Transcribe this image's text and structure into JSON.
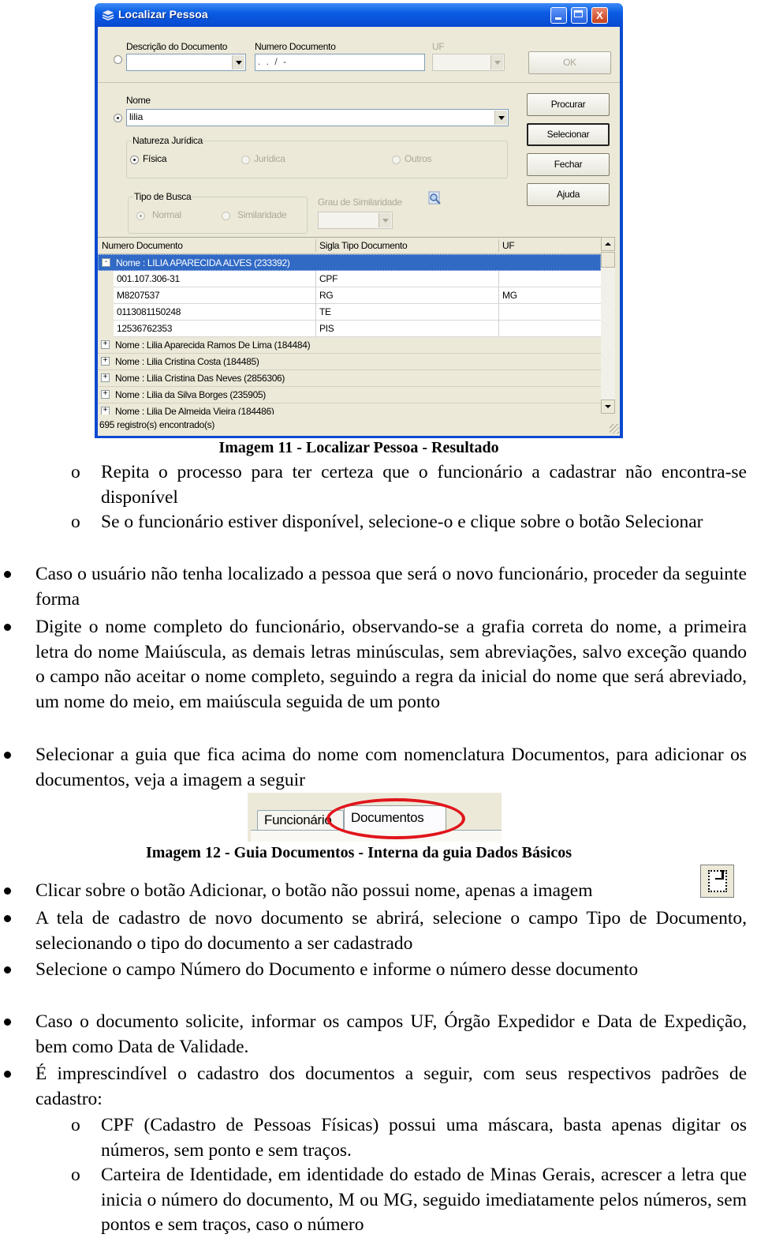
{
  "window": {
    "title": "Localizar Pessoa",
    "title_icon": "stack-icon",
    "controls": [
      "minimize",
      "maximize",
      "close"
    ],
    "close_glyph": "X",
    "document_search": {
      "descricao_label": "Descrição do Documento",
      "descricao_value": "",
      "numero_label": "Numero Documento",
      "numero_value": " .  .  /  -",
      "uf_label": "UF",
      "uf_value": ""
    },
    "name_search": {
      "label": "Nome",
      "value": "lilia"
    },
    "natureza": {
      "title": "Natureza Jurídica",
      "options": [
        "Física",
        "Jurídica",
        "Outros"
      ],
      "selected": "Física"
    },
    "tipo_busca": {
      "title": "Tipo de Busca",
      "options": [
        "Normal",
        "Similaridade"
      ],
      "selected": "Normal"
    },
    "similaridade": {
      "label": "Grau de Similaridade",
      "value": ""
    },
    "buttons": {
      "ok": "OK",
      "procurar": "Procurar",
      "selecionar": "Selecionar",
      "fechar": "Fechar",
      "ajuda": "Ajuda"
    },
    "grid": {
      "columns": [
        "Numero Documento",
        "Sigla Tipo Documento",
        "UF"
      ],
      "expanded_group": {
        "label": "Nome : LILIA APARECIDA ALVES (233392)",
        "toggle": "-",
        "rows": [
          {
            "numero": "001.107.306-31",
            "sigla": "CPF",
            "uf": ""
          },
          {
            "numero": "M8207537",
            "sigla": "RG",
            "uf": "MG"
          },
          {
            "numero": "0113081150248",
            "sigla": "TE",
            "uf": ""
          },
          {
            "numero": "12536762353",
            "sigla": "PIS",
            "uf": ""
          }
        ]
      },
      "collapsed_groups": [
        {
          "label": "Nome : Lilia Aparecida Ramos De Lima (184484)",
          "toggle": "+"
        },
        {
          "label": "Nome : Lilia Cristina Costa (184485)",
          "toggle": "+"
        },
        {
          "label": "Nome : Lilia Cristina Das Neves (2856306)",
          "toggle": "+"
        },
        {
          "label": "Nome : Lilia da Silva Borges (235905)",
          "toggle": "+"
        },
        {
          "label": "Nome : Lilia De Almeida Vieira (184486)",
          "toggle": "+"
        }
      ]
    },
    "status": "695 registro(s) encontrado(s)"
  },
  "doc": {
    "caption1": "Imagem 11 - Localizar Pessoa - Resultado",
    "sub_marker": "o",
    "sub1": "Repita o processo para ter certeza que o funcionário a cadastrar não encontra-se disponível",
    "sub2": "Se o funcionário estiver disponível, selecione-o e clique sobre o botão Selecionar",
    "b1": "Caso o usuário não tenha localizado a pessoa que será o novo funcionário, proceder da seguinte forma",
    "b2": "Digite o nome completo do funcionário, observando-se a grafia correta do nome, a primeira letra do nome Maiúscula, as demais letras minúsculas, sem abreviações, salvo exceção quando o campo não aceitar o nome completo, seguindo a regra da inicial do nome que será abreviado, um nome do meio, em maiúscula seguida de um ponto",
    "b3": "Selecionar a guia que fica acima do nome com nomenclatura Documentos, para adicionar os documentos, veja a imagem a seguir",
    "tab_image": {
      "tabs": [
        "Funcionário",
        "Documentos"
      ],
      "highlighted": "Documentos"
    },
    "caption2": "Imagem 12 - Guia Documentos - Interna da guia Dados Básicos",
    "b4": "Clicar sobre o botão Adicionar, o botão não possui nome, apenas a imagem",
    "b4_icon": "add-document-icon",
    "b5": "A tela de cadastro de novo documento se abrirá, selecione o campo Tipo de Documento, selecionando o tipo do documento a ser cadastrado",
    "b6": "Selecione o campo Número do Documento e informe o número desse documento",
    "b7": "Caso o documento solicite, informar os campos UF, Órgão Expedidor e Data de Expedição, bem como Data de Validade.",
    "b8": "É imprescindível o cadastro dos documentos a seguir, com seus respectivos padrões de cadastro:",
    "sub3": "CPF (Cadastro de Pessoas Físicas) possui uma máscara, basta apenas digitar os números, sem ponto e sem traços.",
    "sub4": "Carteira de Identidade, em identidade do estado de Minas Gerais, acrescer a letra que inicia o número do documento, M ou MG, seguido imediatamente pelos números, sem pontos e sem traços, caso o número"
  }
}
